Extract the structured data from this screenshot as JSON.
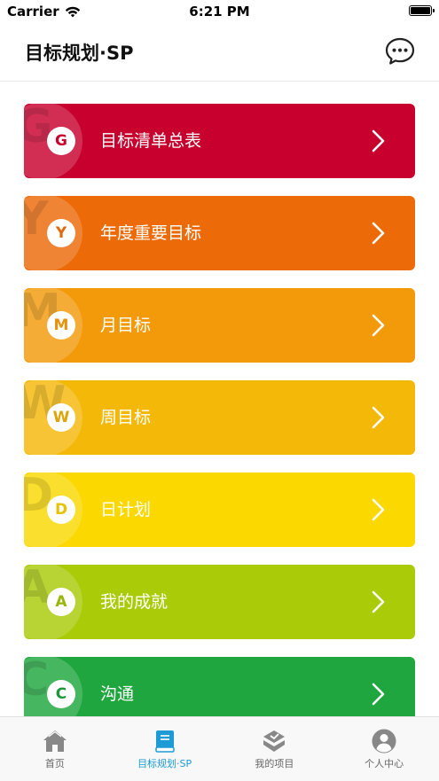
{
  "status_bar": {
    "carrier": "Carrier",
    "time": "6:21 PM"
  },
  "nav": {
    "title": "目标规划·SP",
    "chat_icon": "chat-bubble-icon"
  },
  "menu": [
    {
      "letter": "G",
      "label": "目标清单总表",
      "color": "#C8002E",
      "letter_color": "#C8002E"
    },
    {
      "letter": "Y",
      "label": "年度重要目标",
      "color": "#EC6B08",
      "letter_color": "#E06A08"
    },
    {
      "letter": "M",
      "label": "月目标",
      "color": "#F39A0A",
      "letter_color": "#E6920A"
    },
    {
      "letter": "W",
      "label": "周目标",
      "color": "#F4B808",
      "letter_color": "#DDA508"
    },
    {
      "letter": "D",
      "label": "日计划",
      "color": "#FBD800",
      "letter_color": "#E6C300"
    },
    {
      "letter": "A",
      "label": "我的成就",
      "color": "#A9CB08",
      "letter_color": "#97B707"
    },
    {
      "letter": "C",
      "label": "沟通",
      "color": "#1FA63E",
      "letter_color": "#1C9638"
    }
  ],
  "tabs": [
    {
      "label": "首页",
      "icon": "home-icon",
      "active": false
    },
    {
      "label": "目标规划·SP",
      "icon": "book-icon",
      "active": true
    },
    {
      "label": "我的项目",
      "icon": "project-icon",
      "active": false
    },
    {
      "label": "个人中心",
      "icon": "user-icon",
      "active": false
    }
  ],
  "colors": {
    "accent": "#1E9BD6",
    "tab_inactive": "#666666"
  }
}
